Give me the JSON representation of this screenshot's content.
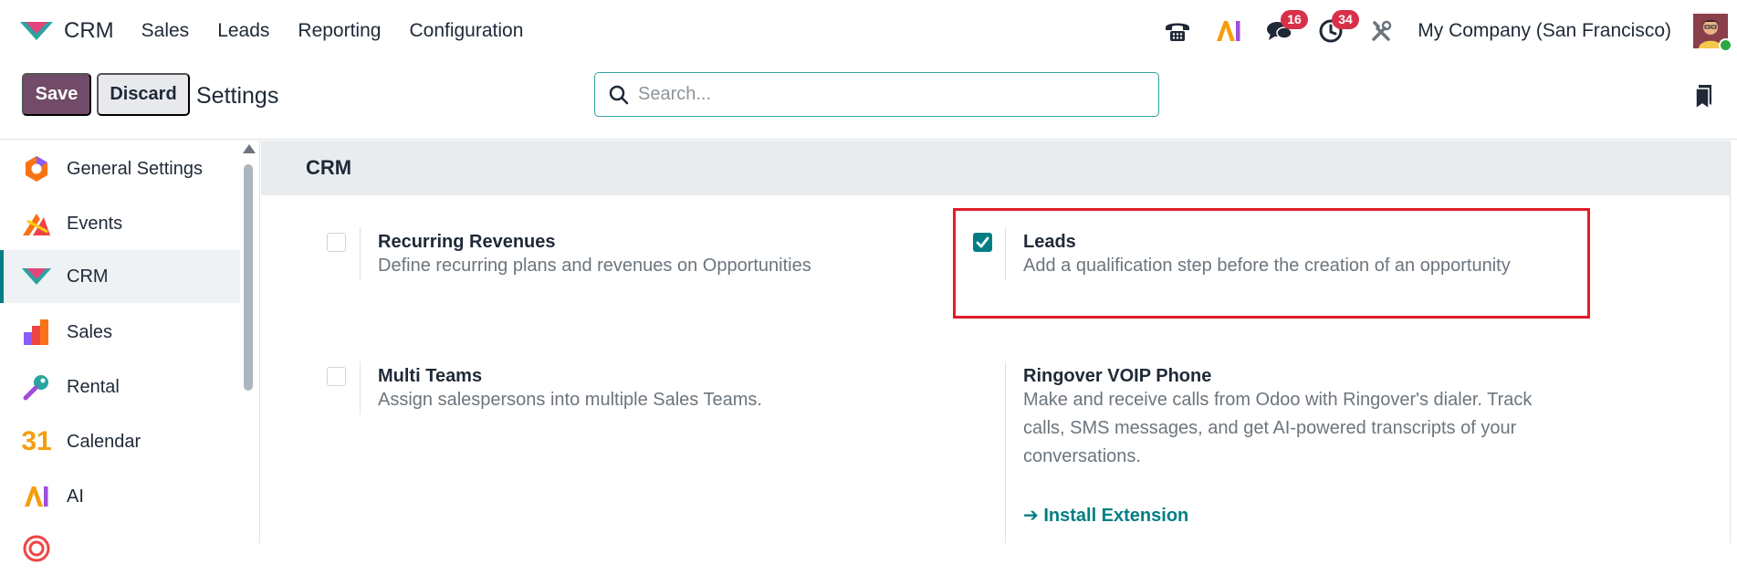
{
  "navbar": {
    "app_name": "CRM",
    "menu": [
      "Sales",
      "Leads",
      "Reporting",
      "Configuration"
    ],
    "messages_badge": "16",
    "activities_badge": "34",
    "company": "My Company (San Francisco)",
    "ai_label": "AI"
  },
  "control_panel": {
    "save_label": "Save",
    "discard_label": "Discard",
    "breadcrumb": "Settings",
    "search_placeholder": "Search..."
  },
  "sidebar": {
    "items": [
      {
        "label": "General Settings",
        "icon": "general-settings-icon"
      },
      {
        "label": "Events",
        "icon": "events-icon"
      },
      {
        "label": "CRM",
        "icon": "crm-icon",
        "active": true
      },
      {
        "label": "Sales",
        "icon": "sales-icon"
      },
      {
        "label": "Rental",
        "icon": "rental-icon"
      },
      {
        "label": "Calendar",
        "icon": "calendar-icon",
        "icon_text": "31"
      },
      {
        "label": "AI",
        "icon": "ai-icon",
        "icon_text": "AI"
      }
    ]
  },
  "section": {
    "title": "CRM",
    "settings": [
      {
        "title": "Recurring Revenues",
        "description": "Define recurring plans and revenues on Opportunities",
        "checked": false
      },
      {
        "title": "Leads",
        "description": "Add a qualification step before the creation of an opportunity",
        "checked": true
      },
      {
        "title": "Multi Teams",
        "description": "Assign salespersons into multiple Sales Teams.",
        "checked": false
      },
      {
        "title": "Ringover VOIP Phone",
        "description": "Make and receive calls from Odoo with Ringover's dialer. Track calls, SMS messages, and get AI-powered transcripts of your conversations.",
        "link": "Install Extension"
      }
    ]
  },
  "colors": {
    "primary": "#714b67",
    "accent": "#017e84",
    "badge": "#d9304a",
    "highlight": "#e11d2a"
  }
}
